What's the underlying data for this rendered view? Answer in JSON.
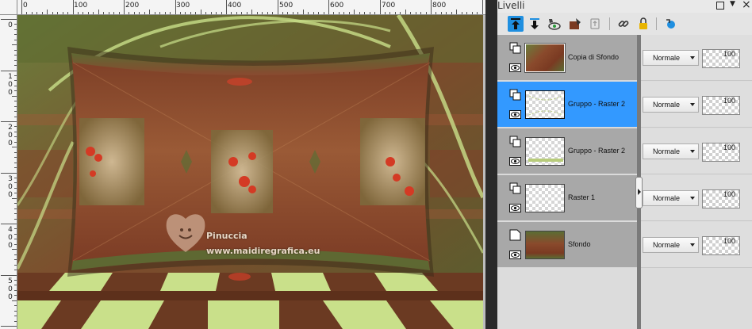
{
  "rulers": {
    "top_labels": [
      "0",
      "100",
      "200",
      "300",
      "400",
      "500",
      "600",
      "700",
      "800"
    ],
    "left_labels": [
      "0",
      "100",
      "200",
      "300",
      "400",
      "500"
    ]
  },
  "canvas": {
    "watermark_name": "Pinuccia",
    "watermark_url": "www.maidiregrafica.eu",
    "colors": {
      "frame_dark": "#4a2a1a",
      "frame_red": "#9a4a32",
      "green": "#6b7d3c",
      "lime": "#c9e08a",
      "brown": "#6a3a22"
    }
  },
  "panel": {
    "title": "Livelli",
    "toolbar_icons": [
      "move-layer-up-icon",
      "move-layer-down-icon",
      "mask-visibility-icon",
      "paint-layer-icon",
      "duplicate-layer-icon",
      "link-icon",
      "lock-icon",
      "reset-icon"
    ],
    "selected_color": "#3399ff"
  },
  "layers": [
    {
      "name": "Copia di Sfondo",
      "blend": "Normale",
      "opacity": "100",
      "thumb": "image",
      "line_icon": "layer-group-icon",
      "selected": false
    },
    {
      "name": "Gruppo - Raster 2",
      "blend": "Normale",
      "opacity": "100",
      "thumb": "transparent-dots",
      "line_icon": "layer-group-icon",
      "selected": true
    },
    {
      "name": "Gruppo - Raster 2",
      "blend": "Normale",
      "opacity": "100",
      "thumb": "transparent-green",
      "line_icon": "layer-group-icon",
      "selected": false
    },
    {
      "name": "Raster 1",
      "blend": "Normale",
      "opacity": "100",
      "thumb": "transparent",
      "line_icon": "layer-group-icon",
      "selected": false
    },
    {
      "name": "Sfondo",
      "blend": "Normale",
      "opacity": "100",
      "thumb": "image",
      "line_icon": "background-layer-icon",
      "selected": false
    }
  ]
}
